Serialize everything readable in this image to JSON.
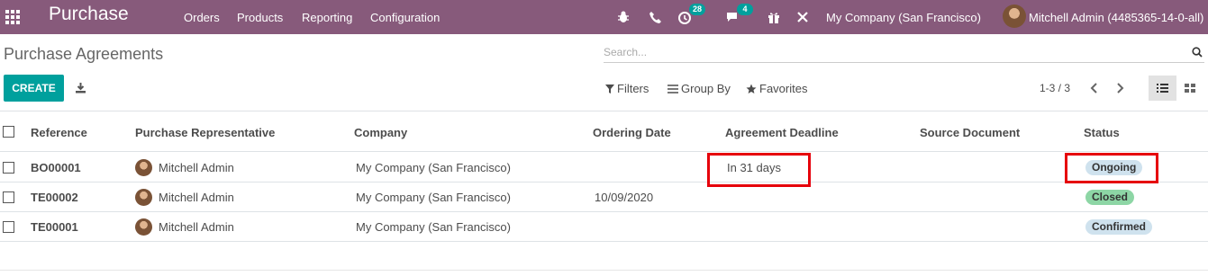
{
  "navbar": {
    "app_title": "Purchase",
    "menu": [
      "Orders",
      "Products",
      "Reporting",
      "Configuration"
    ],
    "activity_count": "28",
    "message_count": "4",
    "company": "My Company (San Francisco)",
    "user": "Mitchell Admin (4485365-14-0-all)"
  },
  "control_panel": {
    "title": "Purchase Agreements",
    "search_placeholder": "Search...",
    "create_label": "CREATE",
    "filters_label": "Filters",
    "groupby_label": "Group By",
    "favorites_label": "Favorites",
    "pager": "1-3 / 3"
  },
  "table": {
    "columns": [
      "Reference",
      "Purchase Representative",
      "Company",
      "Ordering Date",
      "Agreement Deadline",
      "Source Document",
      "Status"
    ],
    "rows": [
      {
        "reference": "BO00001",
        "representative": "Mitchell Admin",
        "company": "My Company (San Francisco)",
        "ordering_date": "",
        "deadline": "In 31 days",
        "source": "",
        "status": "Ongoing"
      },
      {
        "reference": "TE00002",
        "representative": "Mitchell Admin",
        "company": "My Company (San Francisco)",
        "ordering_date": "10/09/2020",
        "deadline": "",
        "source": "",
        "status": "Closed"
      },
      {
        "reference": "TE00001",
        "representative": "Mitchell Admin",
        "company": "My Company (San Francisco)",
        "ordering_date": "",
        "deadline": "",
        "source": "",
        "status": "Confirmed"
      }
    ]
  },
  "colors": {
    "navbar": "#875a7b",
    "accent": "#00a09d",
    "status_ongoing": "#cfe2ee",
    "status_closed": "#8dd6a5",
    "status_confirmed": "#cfe2ee",
    "highlight": "#e6000b"
  }
}
